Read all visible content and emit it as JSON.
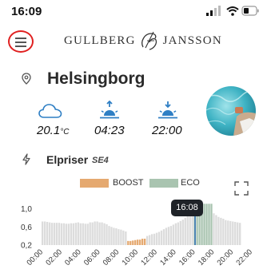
{
  "status_bar": {
    "time": "16:09"
  },
  "header": {
    "brand_left": "GULLBERG",
    "brand_right": "JANSSON"
  },
  "location": {
    "city": "Helsingborg"
  },
  "weather": {
    "temperature": "20.1",
    "temperature_unit": "°C",
    "sunrise": "04:23",
    "sunset": "22:00"
  },
  "electricity": {
    "title": "Elpriser",
    "area": "SE4",
    "legend": [
      {
        "label": "BOOST",
        "color": "#e5a970"
      },
      {
        "label": "ECO",
        "color": "#a9c4b0"
      }
    ],
    "tooltip": "16:08"
  },
  "colors": {
    "normal_bar": "#dcdcdc",
    "boost_bar": "#e5a970",
    "eco_bar": "#a9c4b0",
    "marker": "#2a6db0",
    "weather_icon": "#2f7fc4",
    "menu_highlight": "#e02020"
  },
  "chart_data": {
    "type": "bar",
    "title": "Elpriser",
    "subtitle": "SE4",
    "ylim": [
      0.2,
      1.15
    ],
    "y_ticks": [
      "1,0",
      "0,6",
      "0,2"
    ],
    "y_tick_values": [
      1.0,
      0.6,
      0.2
    ],
    "x_tick_labels": [
      "00:00",
      "02:00",
      "04:00",
      "06:00",
      "08:00",
      "10:00",
      "12:00",
      "14:00",
      "16:00",
      "18:00",
      "20:00",
      "22:00"
    ],
    "grid": false,
    "legend_position": "top-center",
    "current_time_hour": 16.13,
    "series": [
      {
        "name": "",
        "values": [
          0.72,
          0.72,
          0.71,
          0.7,
          0.69,
          0.69,
          0.69,
          0.69,
          0.68,
          0.68,
          0.67,
          0.67,
          0.68,
          0.68,
          0.69,
          0.7,
          0.68,
          0.68,
          0.67,
          0.67,
          0.7,
          0.7,
          0.72,
          0.72,
          0.7,
          0.7,
          0.68,
          0.66,
          0.62,
          0.6,
          0.58,
          0.57,
          0.55,
          0.54,
          0.52,
          0.5,
          0.29,
          0.29,
          0.3,
          0.31,
          0.32,
          0.32,
          0.34,
          0.34,
          0.4,
          0.42,
          0.44,
          0.45,
          0.47,
          0.49,
          0.52,
          0.55,
          0.58,
          0.6,
          0.62,
          0.65,
          0.68,
          0.7,
          0.73,
          0.76,
          0.8,
          0.85,
          0.92,
          1.0,
          1.04,
          1.08,
          1.1,
          1.11,
          1.11,
          1.11,
          1.11,
          1.11,
          0.9,
          0.86,
          0.82,
          0.8,
          0.78,
          0.75,
          0.74,
          0.73,
          0.72,
          0.71,
          0.7,
          0.69
        ],
        "status": [
          "n",
          "n",
          "n",
          "n",
          "n",
          "n",
          "n",
          "n",
          "n",
          "n",
          "n",
          "n",
          "n",
          "n",
          "n",
          "n",
          "n",
          "n",
          "n",
          "n",
          "n",
          "n",
          "n",
          "n",
          "n",
          "n",
          "n",
          "n",
          "n",
          "n",
          "n",
          "n",
          "n",
          "n",
          "n",
          "n",
          "b",
          "b",
          "b",
          "b",
          "b",
          "b",
          "b",
          "b",
          "n",
          "n",
          "n",
          "n",
          "n",
          "n",
          "n",
          "n",
          "n",
          "n",
          "n",
          "n",
          "n",
          "n",
          "n",
          "n",
          "n",
          "n",
          "n",
          "n",
          "e",
          "e",
          "e",
          "e",
          "e",
          "e",
          "e",
          "e",
          "n",
          "n",
          "n",
          "n",
          "n",
          "n",
          "n",
          "n",
          "n",
          "n",
          "n",
          "n"
        ]
      }
    ]
  }
}
